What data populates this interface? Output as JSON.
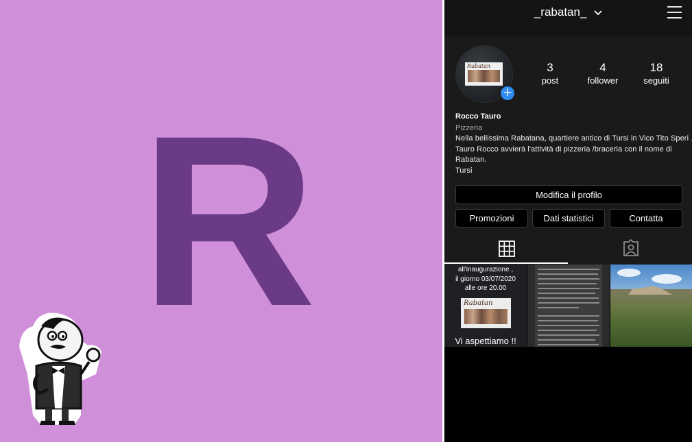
{
  "left_panel": {
    "letter": "R",
    "background_color": "#cf90d9",
    "letter_color": "#6b3a86"
  },
  "profile": {
    "username": "_rabatan_",
    "stats": [
      {
        "value": "3",
        "label": "post"
      },
      {
        "value": "4",
        "label": "follower"
      },
      {
        "value": "18",
        "label": "seguiti"
      }
    ],
    "name": "Rocco Tauro",
    "category": "Pizzeria",
    "bio_lines": [
      "Nella bellissima Rabatana, quartiere antico di Tursi in Vico Tito Speri .",
      "Tauro Rocco avvierà l'attività di pizzeria /braceria con il nome di",
      "Rabatan.",
      "Tursi"
    ],
    "buttons": {
      "edit": "Modifica il profilo",
      "promo": "Promozioni",
      "stats": "Dati statistici",
      "contact": "Contatta"
    }
  },
  "posts": {
    "post1": {
      "line1": "all'inaugurazione ,",
      "line2": "il giorno 03/07/2020",
      "line3": "alle ore 20.00",
      "logo_text": "Rabatan",
      "line4": "Vi aspettiamo !!"
    }
  },
  "icons": {
    "chevron": "chevron-down-icon",
    "menu": "hamburger-menu-icon",
    "add": "plus-icon",
    "grid": "grid-icon",
    "tagged": "tagged-person-icon"
  },
  "colors": {
    "accent_blue": "#2f8cf0"
  }
}
